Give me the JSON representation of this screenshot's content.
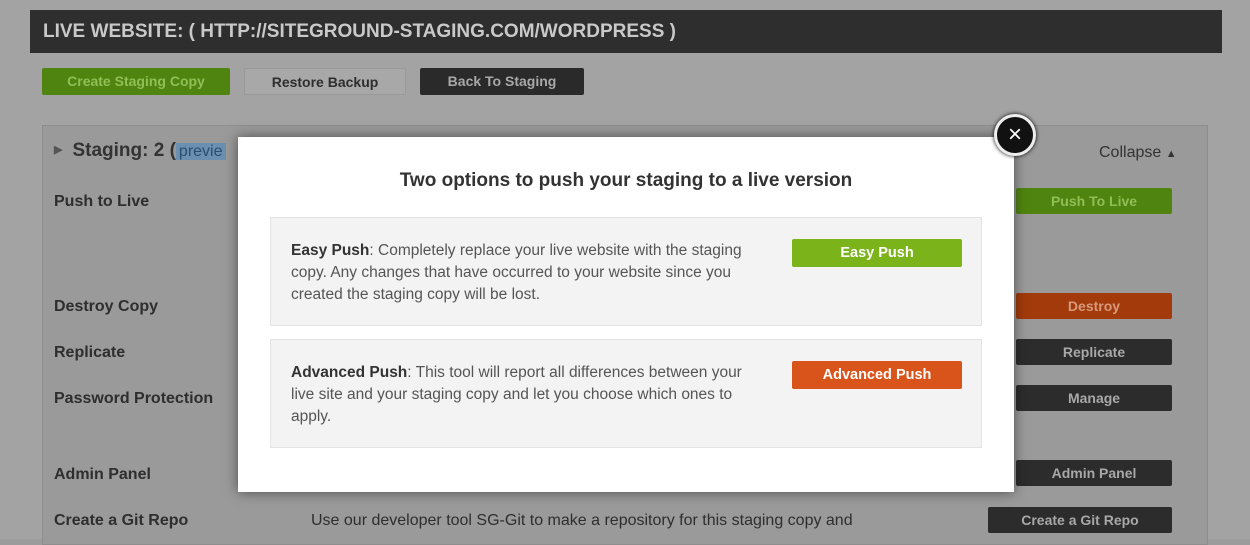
{
  "header": {
    "title": "LIVE WEBSITE: ( HTTP://SITEGROUND-STAGING.COM/WORDPRESS )"
  },
  "toolbar": {
    "create": "Create Staging Copy",
    "restore": "Restore Backup",
    "back": "Back To Staging"
  },
  "staging": {
    "title": "Staging: 2 (",
    "preview": "previe",
    "collapse": "Collapse"
  },
  "rows": [
    {
      "label": "Push to Live",
      "button": "Push To Live"
    },
    {
      "label": "Destroy Copy",
      "button": "Destroy"
    },
    {
      "label": "Replicate",
      "button": "Replicate"
    },
    {
      "label": "Password Protection",
      "button": "Manage"
    },
    {
      "label": "Admin Panel",
      "button": "Admin Panel"
    },
    {
      "label": "Create a Git Repo",
      "button": "Create a Git Repo",
      "description": "Use our developer tool SG-Git to make a repository for this staging copy and"
    }
  ],
  "modal": {
    "title": "Two options to push your staging to a live version",
    "easy": {
      "name": "Easy Push",
      "text": ": Completely replace your live website with the staging copy. Any changes that have occurred to your website since you created the staging copy will be lost.",
      "button": "Easy Push"
    },
    "advanced": {
      "name": "Advanced Push",
      "text": ": This tool will report all differences between your live site and your staging copy and let you choose which ones to apply.",
      "button": "Advanced Push"
    },
    "close": "×"
  },
  "colors": {
    "green": "#7bb31a",
    "orange": "#d9541a",
    "dark": "#2c2c2c"
  }
}
